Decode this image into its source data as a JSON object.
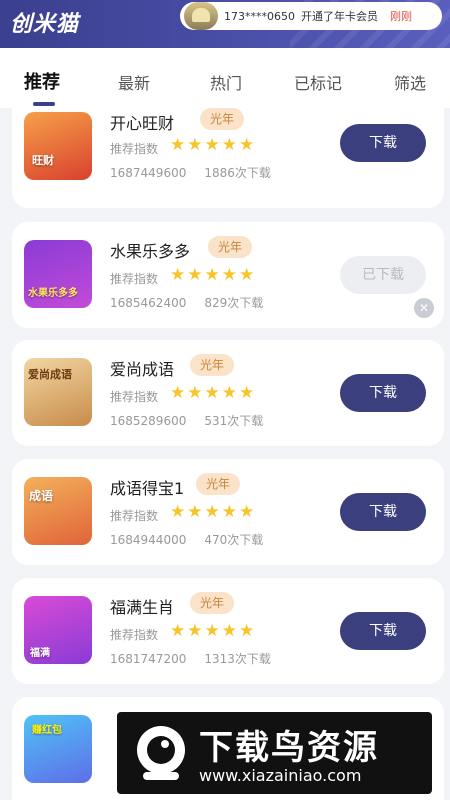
{
  "header": {
    "logo": "创米猫",
    "notice": {
      "phone": "173****0650",
      "message": "开通了年卡会员",
      "time": "刚刚"
    }
  },
  "tabs": [
    {
      "label": "推荐",
      "active": true
    },
    {
      "label": "最新"
    },
    {
      "label": "热门"
    },
    {
      "label": "已标记"
    },
    {
      "label": "筛选"
    }
  ],
  "apps": [
    {
      "name": "开心旺财",
      "badge": "光年",
      "rating_label": "推荐指数",
      "stars": "★★★★★",
      "rating": 5,
      "id": "1687449600",
      "downloads": "1886次下载",
      "action": "下载",
      "icon_text": "旺财"
    },
    {
      "name": "水果乐多多",
      "badge": "光年",
      "rating_label": "推荐指数",
      "stars": "★★★★★",
      "rating": 5,
      "id": "1685462400",
      "downloads": "829次下载",
      "action": "已下载",
      "icon_text": "水果乐多多"
    },
    {
      "name": "爱尚成语",
      "badge": "光年",
      "rating_label": "推荐指数",
      "stars": "★★★★★",
      "rating": 5,
      "id": "1685289600",
      "downloads": "531次下载",
      "action": "下载",
      "icon_text": "爱尚成语"
    },
    {
      "name": "成语得宝1",
      "badge": "光年",
      "rating_label": "推荐指数",
      "stars": "★★★★★",
      "rating": 5,
      "id": "1684944000",
      "downloads": "470次下载",
      "action": "下载",
      "icon_text": "成语"
    },
    {
      "name": "福满生肖",
      "badge": "光年",
      "rating_label": "推荐指数",
      "stars": "★★★★★",
      "rating": 5,
      "id": "1681747200",
      "downloads": "1313次下载",
      "action": "下载",
      "icon_text": "福满"
    },
    {
      "icon_text": "赚红包"
    }
  ],
  "watermark": {
    "title": "下载鸟资源",
    "url": "www.xiazainiao.com"
  },
  "colors": {
    "brand": "#3b3f8f",
    "button": "#3b3f7e",
    "star": "#f7c52b",
    "badge_bg": "#fbe3c9",
    "badge_text": "#c9843e"
  }
}
